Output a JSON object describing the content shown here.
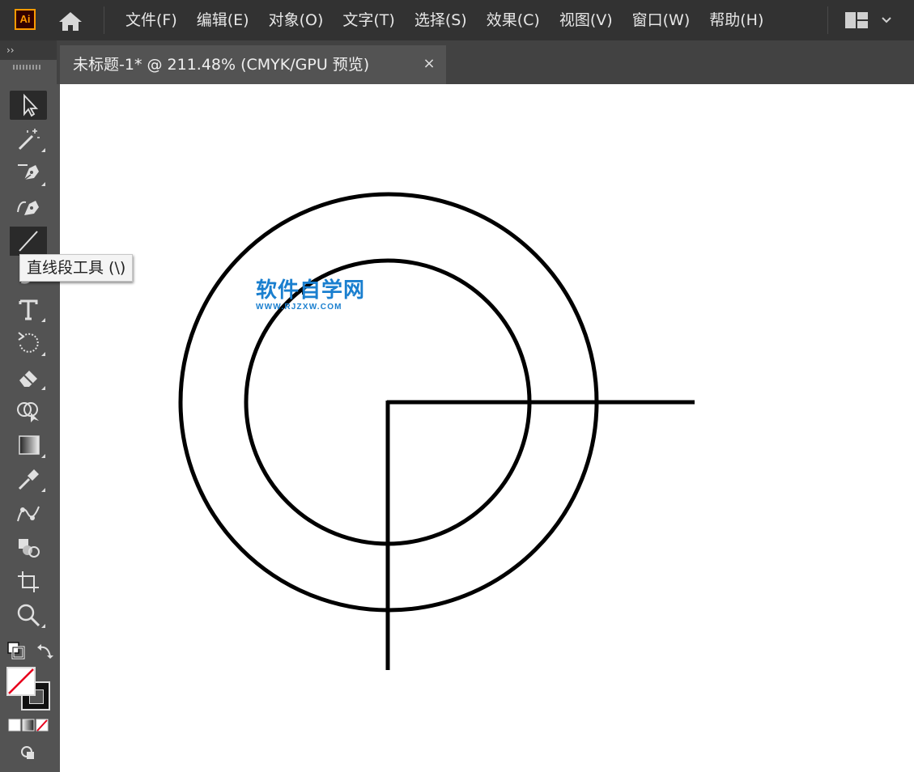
{
  "app": {
    "logo_text": "Ai",
    "accent_color": "#ff9a00",
    "icons": {
      "home": "home-icon",
      "workspace": "workspace-switcher-icon"
    }
  },
  "menu": [
    {
      "label": "文件(F)"
    },
    {
      "label": "编辑(E)"
    },
    {
      "label": "对象(O)"
    },
    {
      "label": "文字(T)"
    },
    {
      "label": "选择(S)"
    },
    {
      "label": "效果(C)"
    },
    {
      "label": "视图(V)"
    },
    {
      "label": "窗口(W)"
    },
    {
      "label": "帮助(H)"
    }
  ],
  "toolbar_collapse_label": "››",
  "document_tab": {
    "title": "未标题-1* @ 211.48% (CMYK/GPU 预览)",
    "close_glyph": "×"
  },
  "tools": [
    {
      "name": "selection-tool-icon",
      "active": true
    },
    {
      "name": "magic-wand-tool-icon"
    },
    {
      "name": "pen-tool-icon"
    },
    {
      "name": "curvature-tool-icon"
    },
    {
      "name": "line-segment-tool-icon",
      "active_hover": true
    },
    {
      "name": "paintbrush-tool-icon"
    },
    {
      "name": "type-tool-icon"
    },
    {
      "name": "rotate-tool-icon"
    },
    {
      "name": "eraser-tool-icon"
    },
    {
      "name": "shape-builder-tool-icon"
    },
    {
      "name": "gradient-tool-icon"
    },
    {
      "name": "eyedropper-tool-icon"
    },
    {
      "name": "puppet-warp-tool-icon"
    },
    {
      "name": "blend-tool-icon"
    },
    {
      "name": "artboard-tool-icon"
    },
    {
      "name": "zoom-tool-icon"
    }
  ],
  "tooltip": "直线段工具 (\\)",
  "color_controls": {
    "fill": "none",
    "stroke": "#000000",
    "default_colors_icon": "default-fill-stroke-icon",
    "swap_icon": "swap-fill-stroke-icon",
    "mode_icons": [
      "color-mode-icon",
      "gradient-mode-icon",
      "none-mode-icon"
    ],
    "draw_mode_icon": "draw-mode-icon"
  },
  "watermark": {
    "text": "软件自学网",
    "url": "WWW.RJZXW.COM",
    "color": "#1a7fcf"
  }
}
